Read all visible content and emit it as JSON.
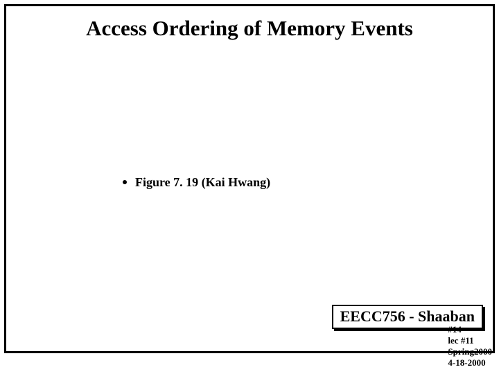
{
  "slide": {
    "title": "Access Ordering of Memory Events",
    "bullet": "Figure 7. 19 (Kai Hwang)"
  },
  "footer": {
    "badge": "EECC756 - Shaaban",
    "page": "#14",
    "lec": "lec #11",
    "term": "Spring2000",
    "date": "4-18-2000"
  }
}
